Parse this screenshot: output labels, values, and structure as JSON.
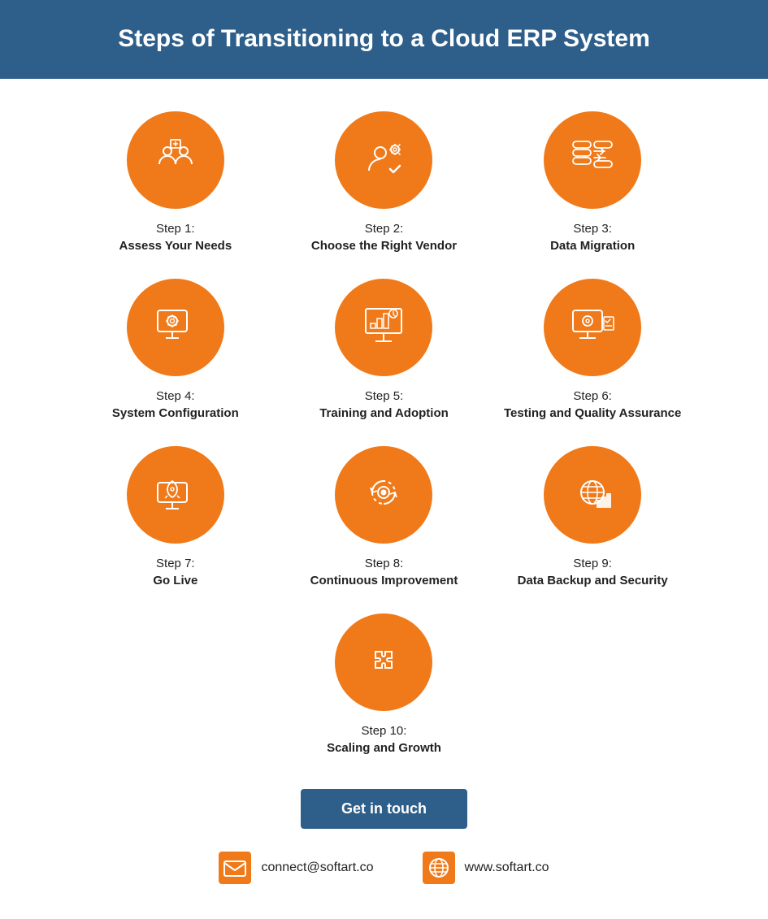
{
  "header": {
    "title": "Steps of Transitioning to a Cloud ERP System"
  },
  "steps": [
    {
      "num": "Step 1:",
      "title": "Assess Your Needs",
      "icon": "assess"
    },
    {
      "num": "Step 2:",
      "title": "Choose the Right Vendor",
      "icon": "vendor"
    },
    {
      "num": "Step 3:",
      "title": "Data Migration",
      "icon": "migration"
    },
    {
      "num": "Step 4:",
      "title": "System Configuration",
      "icon": "config"
    },
    {
      "num": "Step 5:",
      "title": "Training and Adoption",
      "icon": "training"
    },
    {
      "num": "Step 6:",
      "title": "Testing and Quality Assurance",
      "icon": "testing"
    },
    {
      "num": "Step 7:",
      "title": "Go Live",
      "icon": "golive"
    },
    {
      "num": "Step 8:",
      "title": "Continuous Improvement",
      "icon": "continuous"
    },
    {
      "num": "Step 9:",
      "title": "Data Backup and Security",
      "icon": "backup"
    },
    {
      "num": "Step 10:",
      "title": "Scaling and Growth",
      "icon": "scaling"
    }
  ],
  "cta": {
    "button": "Get in touch",
    "email": "connect@softart.co",
    "website": "www.softart.co"
  }
}
